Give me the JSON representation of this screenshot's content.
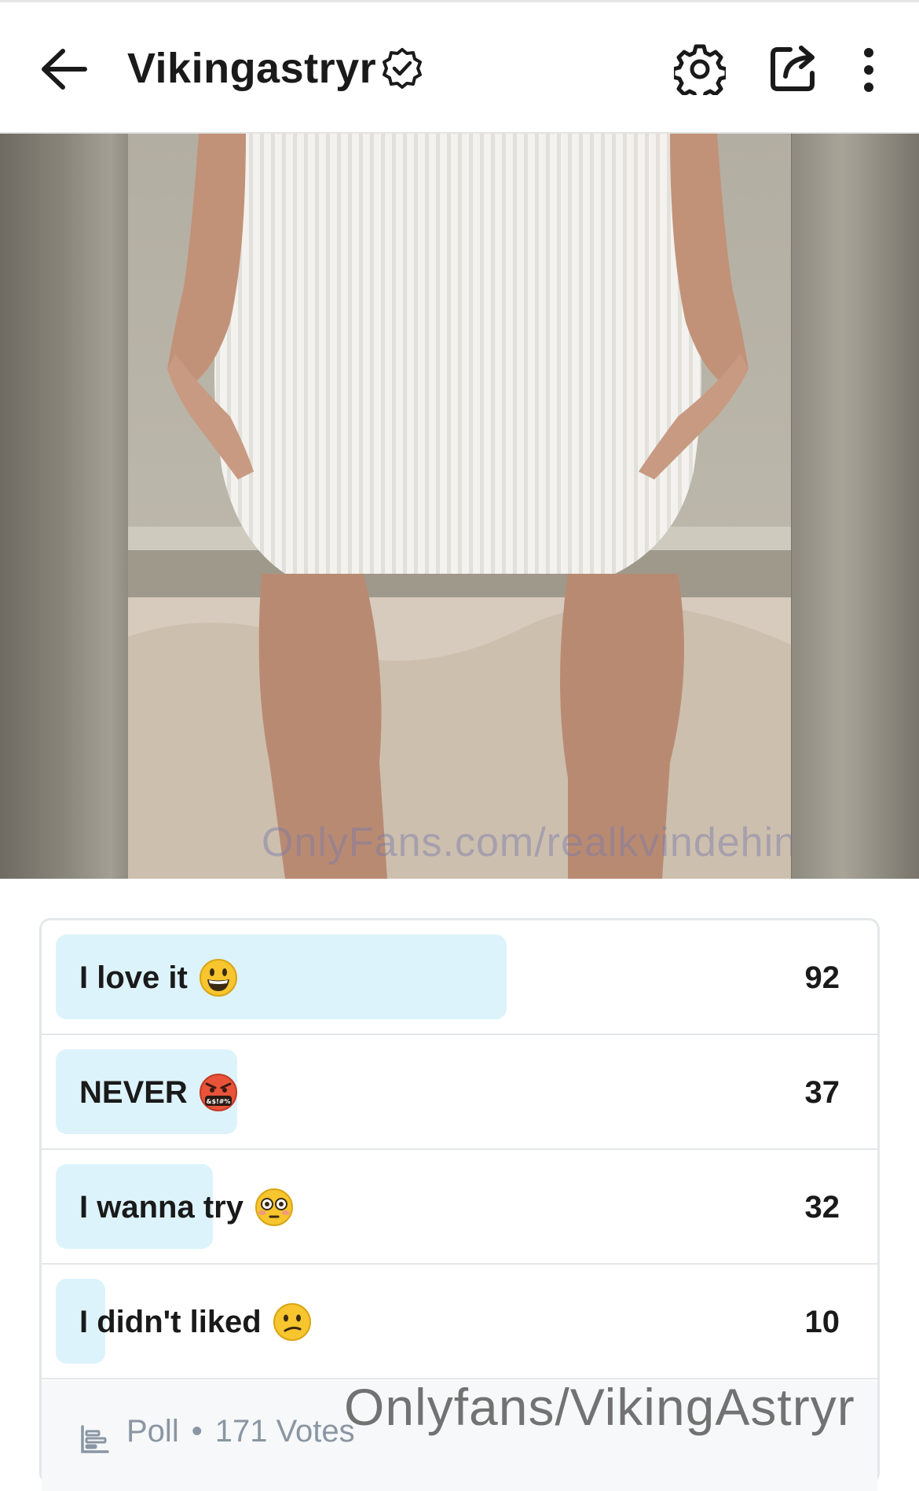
{
  "header": {
    "title": "Vikingastryr",
    "icons": {
      "back": "arrow-left-icon",
      "verified": "verified-badge-icon",
      "settings": "gear-icon",
      "share": "share-icon",
      "more": "more-vertical-icon"
    }
  },
  "media": {
    "watermark": "OnlyFans.com/realkvindehin"
  },
  "poll": {
    "options": [
      {
        "label": "I love it",
        "emoji": "grinning-face",
        "votes": "92"
      },
      {
        "label": "NEVER",
        "emoji": "cursing-face",
        "votes": "37"
      },
      {
        "label": "I wanna try",
        "emoji": "flushed-face",
        "votes": "32"
      },
      {
        "label": "I didn't liked",
        "emoji": "confused-face",
        "votes": "10"
      }
    ],
    "type_label": "Poll",
    "separator": "•",
    "total_votes": "171 Votes"
  },
  "overlay_watermark": "Onlyfans/VikingAstryr",
  "colors": {
    "bar_fill": "#ddf3fb",
    "text": "#1a1a1a",
    "muted": "#8a96a3",
    "border": "#e4e7ea"
  }
}
